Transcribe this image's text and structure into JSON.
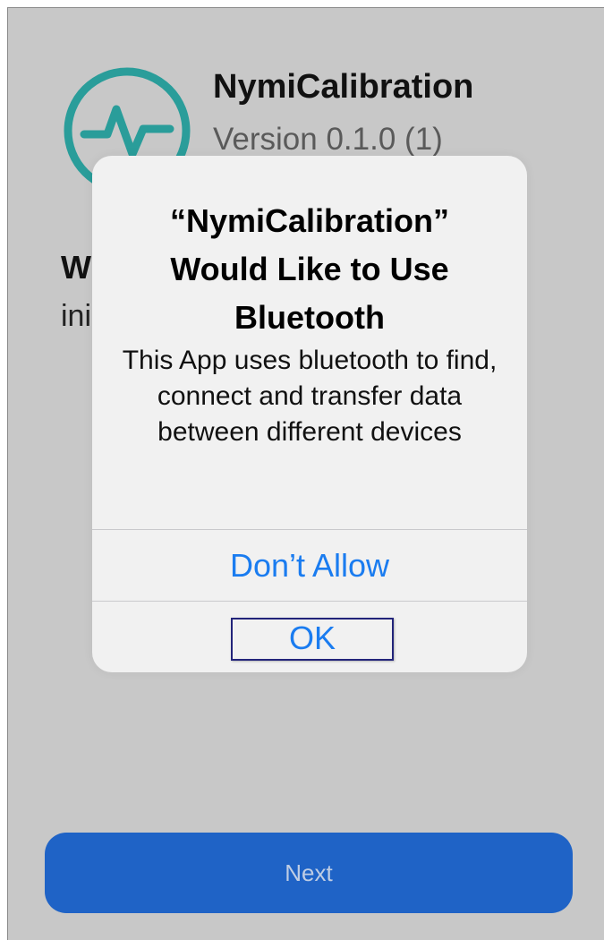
{
  "app": {
    "name": "NymiCalibration",
    "version": "Version 0.1.0 (1)",
    "welcome_heading": "W",
    "status_text": "ini",
    "logo_icon": "pulse-circle-icon",
    "accent_color": "#2a9d9a"
  },
  "alert": {
    "title": "“NymiCalibration” Would Like to Use Bluetooth",
    "message": "This App uses bluetooth to find, connect and transfer data between different devices",
    "dont_allow_label": "Don’t Allow",
    "ok_label": "OK",
    "action_color": "#1a7cf0"
  },
  "footer": {
    "next_label": "Next",
    "button_color": "#1f63c6"
  }
}
